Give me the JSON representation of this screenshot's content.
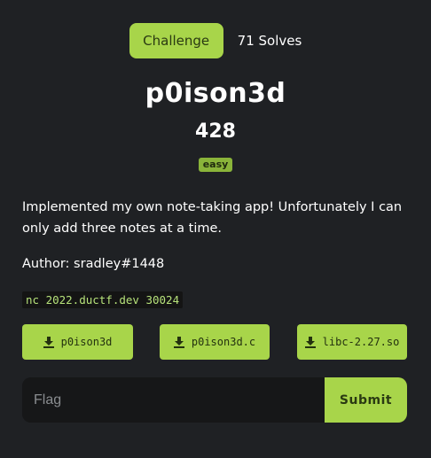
{
  "tabs": {
    "challenge_label": "Challenge",
    "solves_label": "71 Solves"
  },
  "challenge": {
    "name": "p0ison3d",
    "points": "428",
    "difficulty": "easy",
    "description": "Implemented my own note-taking app! Unfortunately I can only add three notes at a time.",
    "author": "Author: sradley#1448",
    "connection": "nc 2022.ductf.dev 30024"
  },
  "files": [
    {
      "label": "p0ison3d",
      "icon": "download-icon"
    },
    {
      "label": "p0ison3d.c",
      "icon": "download-icon"
    },
    {
      "label": "libc-2.27.so",
      "icon": "download-icon"
    }
  ],
  "flag_form": {
    "placeholder": "Flag",
    "submit_label": "Submit"
  },
  "colors": {
    "background": "#1f2124",
    "accent": "#a8d54a",
    "accent_text": "#2a3a12"
  }
}
